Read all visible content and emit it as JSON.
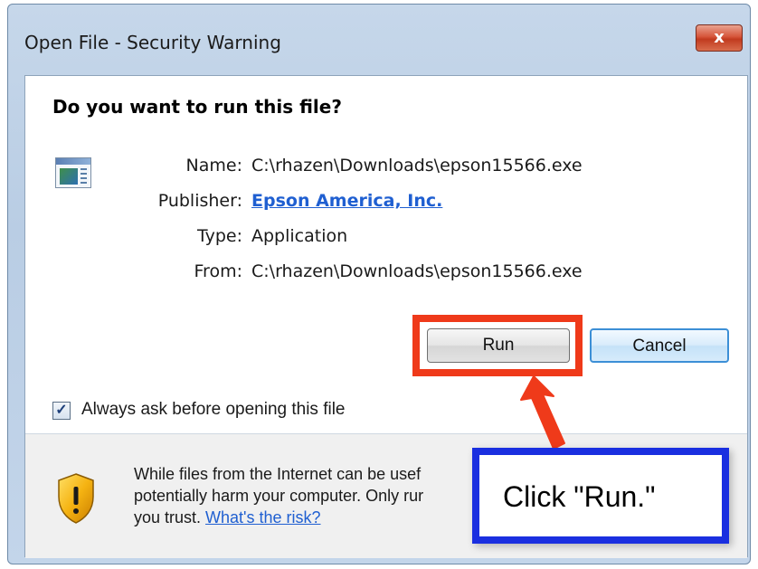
{
  "window": {
    "title": "Open File - Security Warning",
    "close_label": "x"
  },
  "dialog": {
    "question": "Do you want to run this file?",
    "details": [
      {
        "label": "Name:",
        "value": "C:\\rhazen\\Downloads\\epson15566.exe"
      },
      {
        "label": "Publisher:",
        "value": "Epson America, Inc."
      },
      {
        "label": "Type:",
        "value": "Application"
      },
      {
        "label": "From:",
        "value": "C:\\rhazen\\Downloads\\epson15566.exe"
      }
    ],
    "run_label": "Run",
    "cancel_label": "Cancel",
    "checkbox_label": "Always ask before opening this file",
    "checkbox_checked": true
  },
  "footer": {
    "warning_line1": "While files from the Internet can be usef",
    "warning_line2": "potentially harm your computer. Only rur",
    "warning_line3_prefix": "you trust.",
    "risk_link": "What's the risk?"
  },
  "annotation": {
    "callout_text": "Click \"Run.\"",
    "highlight_color": "#ef3a1a",
    "callout_border_color": "#1a2fe0"
  },
  "icons": {
    "file": "application-file-icon",
    "shield": "security-shield-icon",
    "check": "check-icon",
    "arrow": "arrow-up-left-icon"
  }
}
